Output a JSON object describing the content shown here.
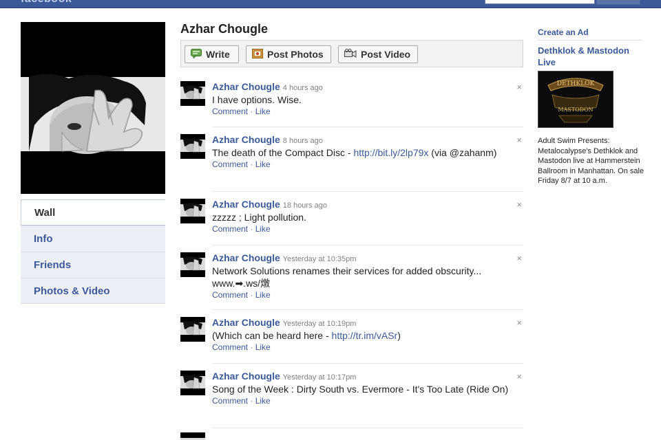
{
  "header": {
    "logo": "facebook",
    "nav_text": ""
  },
  "profile": {
    "name": "Azhar Chougle",
    "nav": [
      "Wall",
      "Info",
      "Friends",
      "Photos & Video"
    ]
  },
  "publisher": {
    "write": "Write",
    "post_photos": "Post Photos",
    "post_video": "Post Video"
  },
  "stories": [
    {
      "actor": "Azhar Chougle",
      "time": "4 hours ago",
      "text": "I have options. Wise.",
      "link": "",
      "suffix": ""
    },
    {
      "actor": "Azhar Chougle",
      "time": "8 hours ago",
      "text": "The death of the Compact Disc - ",
      "link": "http://bit.ly/2lp79x",
      "suffix": " (via @zahanm)"
    },
    {
      "actor": "Azhar Chougle",
      "time": "18 hours ago",
      "text": "zzzzz ; Light pollution.",
      "link": "",
      "suffix": ""
    },
    {
      "actor": "Azhar Chougle",
      "time": "Yesterday at 10:35pm",
      "text": "Network Solutions renames their services for added obscurity... www.➡.ws/燉",
      "link": "",
      "suffix": ""
    },
    {
      "actor": "Azhar Chougle",
      "time": "Yesterday at 10:19pm",
      "text": "(Which can be heard here - ",
      "link": "http://tr.im/vASr",
      "suffix": ")"
    },
    {
      "actor": "Azhar Chougle",
      "time": "Yesterday at 10:17pm",
      "text": "Song of the Week : Dirty South vs. Evermore - It's Too Late (Ride On)",
      "link": "",
      "suffix": ""
    }
  ],
  "story_actions": {
    "comment": "Comment",
    "sep": " · ",
    "like": "Like",
    "close": "×"
  },
  "sidebar": {
    "create_ad": "Create an Ad",
    "ad_title": "Dethklok & Mastodon Live",
    "ad_body": "Adult Swim Presents: Metalocalypse's Dethklok and Mastodon live at Hammerstein Ballroom in Manhattan. On sale Friday 8/7 at 10 a.m.",
    "ad_image_text_top": "DETHKLOK",
    "ad_image_text_bottom": "MASTODON"
  },
  "colors": {
    "brand": "#3b5998",
    "nav_bg": "#eceff5"
  }
}
